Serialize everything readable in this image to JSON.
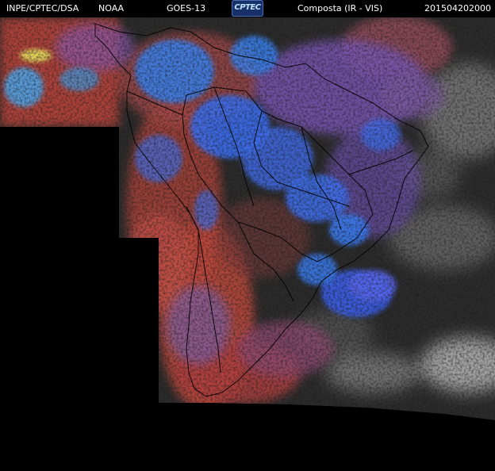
{
  "header": {
    "organization": "INPE/CPTEC/DSA",
    "agency": "NOAA",
    "satellite": "GOES-13",
    "product": "Composta (IR - VIS)",
    "timestamp": "201504202000"
  },
  "logo": {
    "text": "CPTEC"
  },
  "colors": {
    "background": "#000000",
    "land_dark": "#2a2a2a",
    "ocean_gray": "#3a3a3a",
    "warm_cloud_red": "#c9473c",
    "cold_cloud_blue": "#3f6fe8",
    "mid_cloud_purple": "#7a5ab0",
    "ocean_cloud_white": "#cfcfcf",
    "cirrus_yellow": "#e8e060",
    "header_text": "#ffffff"
  }
}
